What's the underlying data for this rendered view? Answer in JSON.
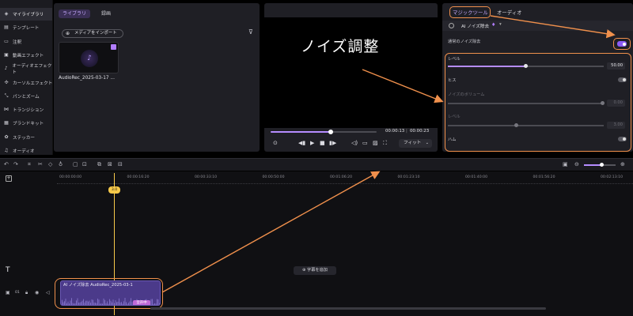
{
  "sidebar": {
    "items": [
      {
        "label": "マイライブラリ",
        "icon": "layers-icon",
        "glyph": "◈",
        "active": true
      },
      {
        "label": "テンプレート",
        "icon": "template-icon",
        "glyph": "▤"
      },
      {
        "label": "注釈",
        "icon": "comment-icon",
        "glyph": "▭"
      },
      {
        "label": "動画エフェクト",
        "icon": "video-effect-icon",
        "glyph": "▣"
      },
      {
        "label": "オーディオエフェクト",
        "icon": "audio-effect-icon",
        "glyph": "♪"
      },
      {
        "label": "カーソルエフェクト",
        "icon": "cursor-effect-icon",
        "glyph": "✣"
      },
      {
        "label": "パンとズーム",
        "icon": "pan-zoom-icon",
        "glyph": "⤡"
      },
      {
        "label": "トランジション",
        "icon": "transition-icon",
        "glyph": "⋈"
      },
      {
        "label": "ブランドキット",
        "icon": "brand-kit-icon",
        "glyph": "▦"
      },
      {
        "label": "ステッカー",
        "icon": "sticker-icon",
        "glyph": "✿"
      },
      {
        "label": "オーディオ",
        "icon": "audio-icon",
        "glyph": "♫"
      }
    ]
  },
  "library": {
    "tabs": [
      {
        "label": "ライブラリ",
        "active": true
      },
      {
        "label": "録画",
        "active": false
      }
    ],
    "import_label": "メディアをインポート",
    "media": {
      "name": "AudioRec_2025-03-17 ..."
    }
  },
  "preview": {
    "overlay_text": "ノイズ調整",
    "progress": 0.57,
    "time_current": "00:00:13",
    "time_separator": "|",
    "time_total": "00:00:23",
    "fit_label": "フィット"
  },
  "props": {
    "tabs": {
      "magic": "マジックツール",
      "audio": "オーディオ"
    },
    "ai_title": "AI ノイズ除去",
    "noise_label": "通常のノイズ除去",
    "noise_enabled": true,
    "level": {
      "label": "レベル",
      "value": "50.00",
      "fraction": 0.5
    },
    "hiss": {
      "label": "ヒス",
      "enabled": false
    },
    "noise_volume": {
      "label": "ノイズのボリューム",
      "value": "0.00",
      "fraction": 0.99
    },
    "level2": {
      "label": "レベル",
      "value": "3.00",
      "fraction": 0.44
    },
    "hum": {
      "label": "ハム",
      "enabled": false
    }
  },
  "timeline": {
    "ruler": [
      "00:00:00:00",
      "00:00:16:20",
      "00:00:33:10",
      "00:00:50:00",
      "00:01:06:20",
      "00:01:23:10",
      "00:01:40:00",
      "00:01:56:20",
      "00:02:13:10"
    ],
    "playhead_label": "3.0",
    "add_subtitle": "字幕を追加",
    "track_number": "01",
    "clip": {
      "label": "AI ノイズ除去   AudioRec_2025-03-1",
      "badge": "音声中"
    }
  },
  "colors": {
    "accent": "#b58cff",
    "highlight": "#f0904c",
    "playhead": "#f6c94a"
  }
}
